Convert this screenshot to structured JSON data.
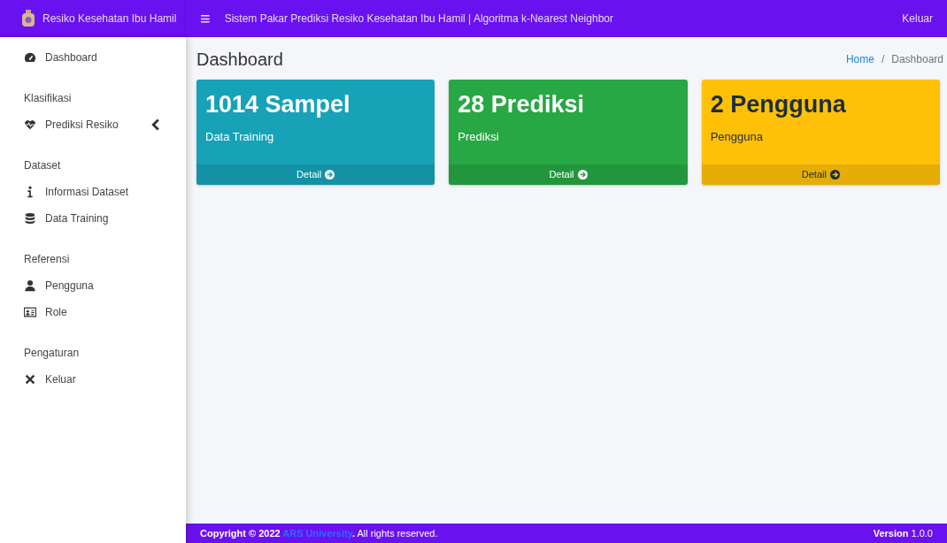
{
  "brand": {
    "title": "Resiko Kesehatan Ibu Hamil"
  },
  "topbar": {
    "menu_glyph": "≡",
    "title": "Sistem Pakar Prediksi Resiko Kesehatan Ibu Hamil | Algoritma k-Nearest Neighbor",
    "logout": "Keluar"
  },
  "sidebar": {
    "sections": [
      {
        "items": [
          {
            "label": "Dashboard"
          }
        ]
      },
      {
        "header": "Klasifikasi",
        "items": [
          {
            "label": "Prediksi Resiko",
            "expanded": false
          }
        ]
      },
      {
        "header": "Dataset",
        "items": [
          {
            "label": "Informasi Dataset"
          },
          {
            "label": "Data Training"
          }
        ]
      },
      {
        "header": "Referensi",
        "items": [
          {
            "label": "Pengguna"
          },
          {
            "label": "Role"
          }
        ]
      },
      {
        "header": "Pengaturan",
        "items": [
          {
            "label": "Keluar"
          }
        ]
      }
    ]
  },
  "page": {
    "title": "Dashboard",
    "separator": "/",
    "breadcrumb": [
      {
        "label": "Home",
        "selected": false
      },
      {
        "label": "Dashboard",
        "selected": true
      }
    ]
  },
  "cards": [
    {
      "value": "1014 Sampel",
      "label": "Data Training",
      "link": "Detail",
      "color": "#17a2b8"
    },
    {
      "value": "28 Prediksi",
      "label": "Prediksi",
      "link": "Detail",
      "color": "#28a745"
    },
    {
      "value": "2 Pengguna",
      "label": "Pengguna",
      "link": "Detail",
      "color": "#ffc107"
    }
  ],
  "footer": {
    "prefix": "Copyright © 2022",
    "link": "ARS University",
    "suffix": "**.** All rights reserved.",
    "version": "**Version** 1.0.0"
  }
}
